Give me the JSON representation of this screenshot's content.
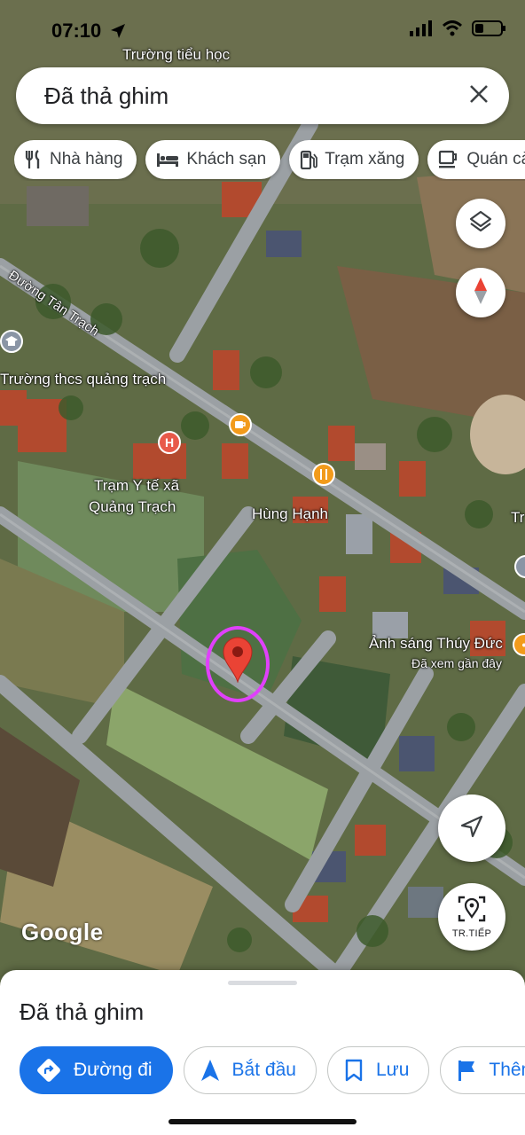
{
  "status_bar": {
    "time": "07:10"
  },
  "search": {
    "query": "Đã thả ghim"
  },
  "chips": [
    {
      "label": "Nhà hàng",
      "icon": "restaurant-icon"
    },
    {
      "label": "Khách sạn",
      "icon": "hotel-icon"
    },
    {
      "label": "Trạm xăng",
      "icon": "gas-station-icon"
    },
    {
      "label": "Quán cà phê",
      "icon": "coffee-icon"
    }
  ],
  "map_labels": {
    "top_school": "Trường tiểu học",
    "road": "Đường Tân Trạch",
    "school": "Trường thcs quảng trạch",
    "clinic_line1": "Trạm Y tế xã",
    "clinic_line2": "Quảng Trạch",
    "restaurant": "Hùng Hạnh",
    "studio": "Ảnh sáng Thúy Đức",
    "studio_sub": "Đã xem gần đây",
    "edge_label": "Tr"
  },
  "buttons": {
    "next_label": "TR.TIẾP"
  },
  "google_logo": "Google",
  "sheet": {
    "title": "Đã thả ghim",
    "actions": [
      {
        "label": "Đường đi",
        "icon": "directions-icon"
      },
      {
        "label": "Bắt đầu",
        "icon": "navigation-arrow-icon"
      },
      {
        "label": "Lưu",
        "icon": "bookmark-icon"
      },
      {
        "label": "Thêm nhãn",
        "icon": "flag-icon"
      }
    ]
  },
  "colors": {
    "accent_blue": "#1a73e8",
    "pin_red": "#ea4335",
    "highlight_ring": "#e040fb",
    "poi_orange": "#f29b1b"
  }
}
